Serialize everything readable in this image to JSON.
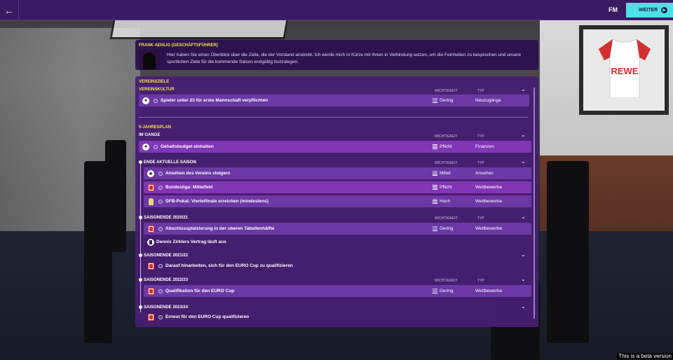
{
  "topbar": {
    "back_icon": "arrow-left-icon",
    "logo": "FM",
    "continue_label": "WEITER",
    "continue_color": "#4ee0e6"
  },
  "message": {
    "sender": "FRANK AEHLIG (GESCHÄFTSFÜHRER)",
    "line1": "Hier haben Sie einen Überblick über die Ziele, die der Vorstand anstrebt. Ich werde mich in Kürze mit Ihnen in Verbindung setzen, um die Feinheiten zu besprechen und unsere",
    "line2": "sportlichen Ziele für die kommende Saison endgültig festzulegen."
  },
  "goals": {
    "title": "VEREINSZIELE",
    "club_culture": {
      "title": "VEREINSKULTUR",
      "col_importance": "WICHTIGKEIT",
      "col_type": "TYP",
      "rows": [
        {
          "icon": "player-icon",
          "label": "Spieler unter 23 für erste Mannschaft verpflichten",
          "importance": "Gering",
          "type": "Neuzugänge"
        }
      ]
    },
    "five_year_plan": {
      "title": "5-JAHRESPLAN",
      "in_progress": {
        "title": "IM GANGE",
        "col_importance": "WICHTIGKEIT",
        "col_type": "TYP",
        "rows": [
          {
            "icon": "finance-icon",
            "label": "Gehaltsbudget einhalten",
            "importance": "Pflicht",
            "type": "Finanzen"
          }
        ]
      },
      "current_season": {
        "title": "ENDE AKTUELLE SAISON",
        "col_importance": "WICHTIGKEIT",
        "col_type": "TYP",
        "rows": [
          {
            "icon": "reputation-icon",
            "label": "Ansehen des Vereins steigern",
            "importance": "Mittel",
            "type": "Ansehen"
          },
          {
            "icon": "bundesliga-icon",
            "label": "Bundesliga: Mittelfeld",
            "importance": "Pflicht",
            "type": "Wettbewerbe"
          },
          {
            "icon": "dfb-pokal-icon",
            "label": "DFB-Pokal: Viertelfinale erreichen (mindestens)",
            "importance": "Hoch",
            "type": "Wettbewerbe"
          }
        ]
      },
      "season_2020_21": {
        "title": "SAISONENDE 2020/21",
        "col_importance": "WICHTIGKEIT",
        "col_type": "TYP",
        "rows": [
          {
            "icon": "bundesliga-icon",
            "label": "Abschlussplatzierung in der oberen Tabellenhälfte",
            "importance": "Gering",
            "type": "Wettbewerbe"
          },
          {
            "icon": "contract-icon",
            "label": "Dennis Zirklers Vertrag läuft aus",
            "importance": "",
            "type": ""
          }
        ]
      },
      "season_2021_22": {
        "title": "SAISONENDE 2021/22",
        "rows": [
          {
            "icon": "bundesliga-icon",
            "label": "Darauf hinarbeiten, sich für den EURO Cup zu qualifizieren",
            "importance": "",
            "type": ""
          }
        ]
      },
      "season_2022_23": {
        "title": "SAISONENDE 2022/23",
        "col_importance": "WICHTIGKEIT",
        "col_type": "TYP",
        "rows": [
          {
            "icon": "bundesliga-icon",
            "label": "Qualifikation für den EURO Cup",
            "importance": "Gering",
            "type": "Wettbewerbe"
          }
        ]
      },
      "season_2023_24": {
        "title": "SAISONENDE 2023/24",
        "rows": [
          {
            "icon": "bundesliga-icon",
            "label": "Erneut für den EURO Cup qualifizieren",
            "importance": "",
            "type": ""
          }
        ]
      }
    }
  },
  "background": {
    "jersey_sponsor": "REWE"
  },
  "footer": {
    "beta_notice": "This is a beta version"
  }
}
